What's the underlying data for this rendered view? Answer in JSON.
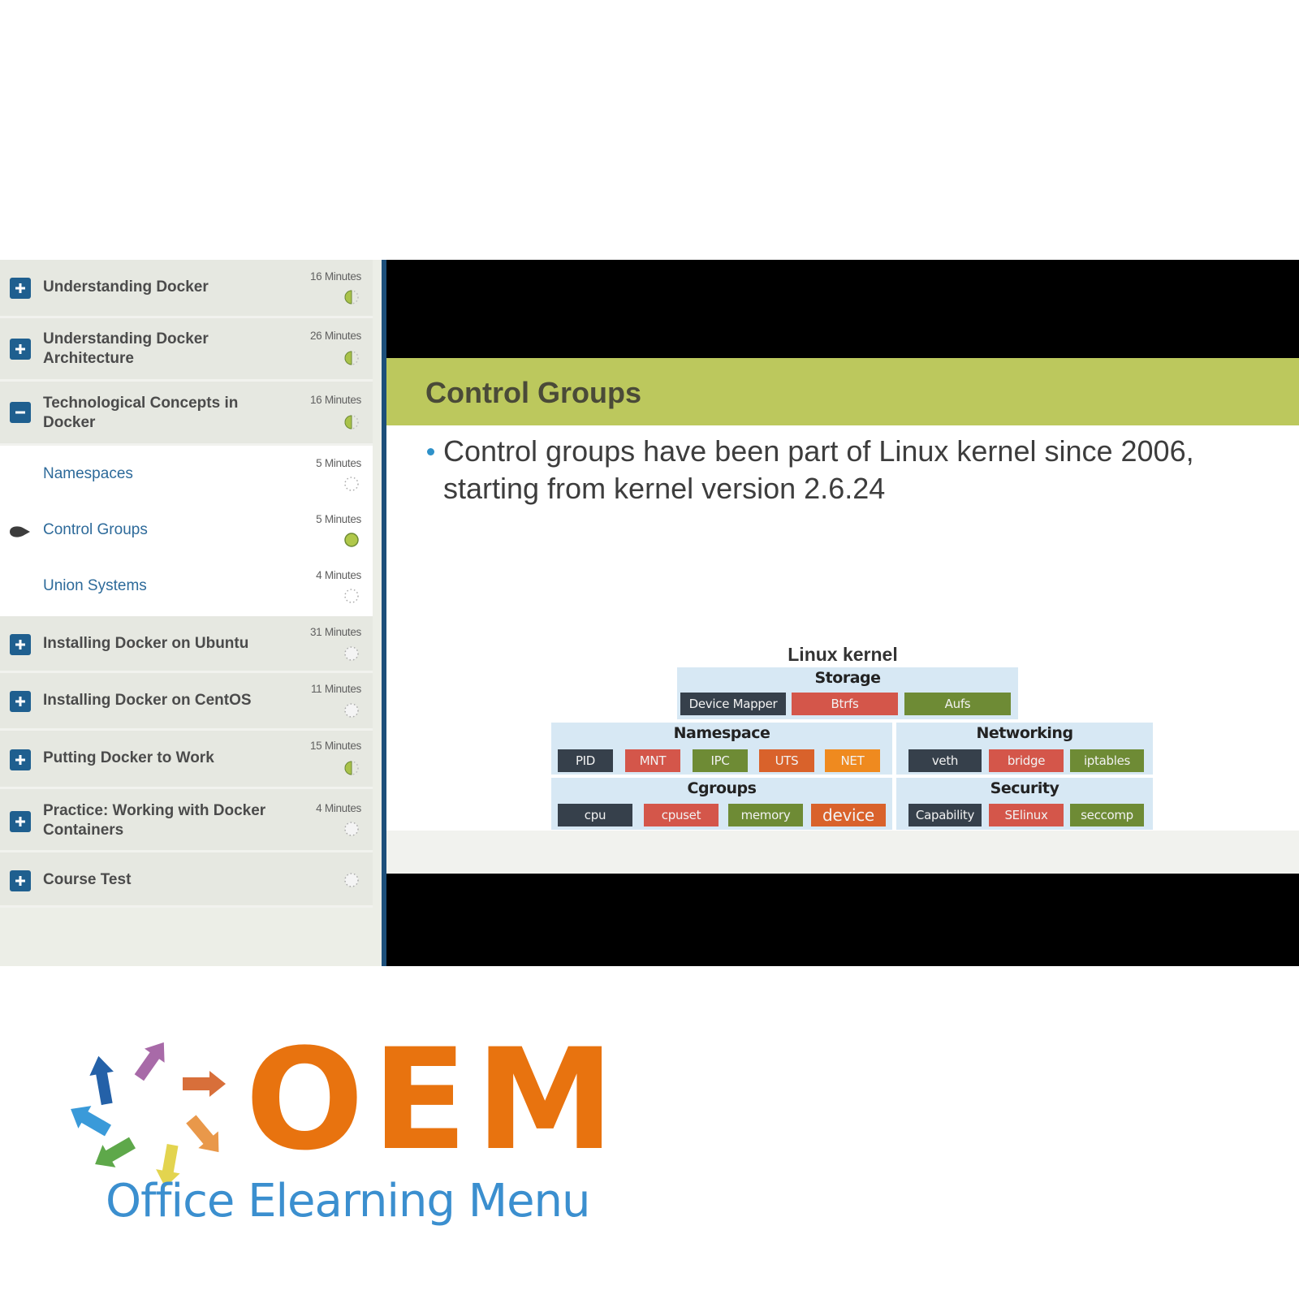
{
  "sidebar": {
    "modules": [
      {
        "title": "Understanding Docker",
        "duration": "16 Minutes",
        "state": "collapsed",
        "progress": "partial"
      },
      {
        "title": "Understanding Docker Architecture",
        "duration": "26 Minutes",
        "state": "collapsed",
        "progress": "partial"
      },
      {
        "title": "Technological Concepts in Docker",
        "duration": "16 Minutes",
        "state": "expanded",
        "progress": "partial",
        "lessons": [
          {
            "title": "Namespaces",
            "duration": "5 Minutes",
            "progress": "not-started",
            "current": false
          },
          {
            "title": "Control Groups",
            "duration": "5 Minutes",
            "progress": "complete",
            "current": true
          },
          {
            "title": "Union Systems",
            "duration": "4 Minutes",
            "progress": "not-started",
            "current": false
          }
        ]
      },
      {
        "title": "Installing Docker on Ubuntu",
        "duration": "31 Minutes",
        "state": "collapsed",
        "progress": "not-started"
      },
      {
        "title": "Installing Docker on CentOS",
        "duration": "11 Minutes",
        "state": "collapsed",
        "progress": "not-started"
      },
      {
        "title": "Putting Docker to Work",
        "duration": "15 Minutes",
        "state": "collapsed",
        "progress": "partial"
      },
      {
        "title": "Practice: Working with Docker Containers",
        "duration": "4 Minutes",
        "state": "collapsed",
        "progress": "not-started"
      },
      {
        "title": "Course Test",
        "duration": "",
        "state": "collapsed",
        "progress": "not-started"
      }
    ]
  },
  "slide": {
    "title": "Control Groups",
    "bullet": "Control groups have been part of Linux kernel since 2006, starting from kernel version 2.6.24",
    "diagram": {
      "title": "Linux kernel",
      "groups": {
        "storage": {
          "label": "Storage",
          "items": [
            "Device Mapper",
            "Btrfs",
            "Aufs"
          ]
        },
        "namespace": {
          "label": "Namespace",
          "items": [
            "PID",
            "MNT",
            "IPC",
            "UTS",
            "NET"
          ]
        },
        "networking": {
          "label": "Networking",
          "items": [
            "veth",
            "bridge",
            "iptables"
          ]
        },
        "cgroups": {
          "label": "Cgroups",
          "items": [
            "cpu",
            "cpuset",
            "memory",
            "device"
          ]
        },
        "security": {
          "label": "Security",
          "items": [
            "Capability",
            "SElinux",
            "seccomp"
          ]
        }
      }
    }
  },
  "colors": {
    "accent_blue": "#1f5f8f",
    "slide_header": "#bcc85d",
    "progress_green": "#a9c24a",
    "logo_orange": "#e8730f",
    "logo_blue": "#3b8fcf"
  },
  "logo": {
    "mark": "OEM",
    "tagline": "Office Elearning Menu"
  }
}
